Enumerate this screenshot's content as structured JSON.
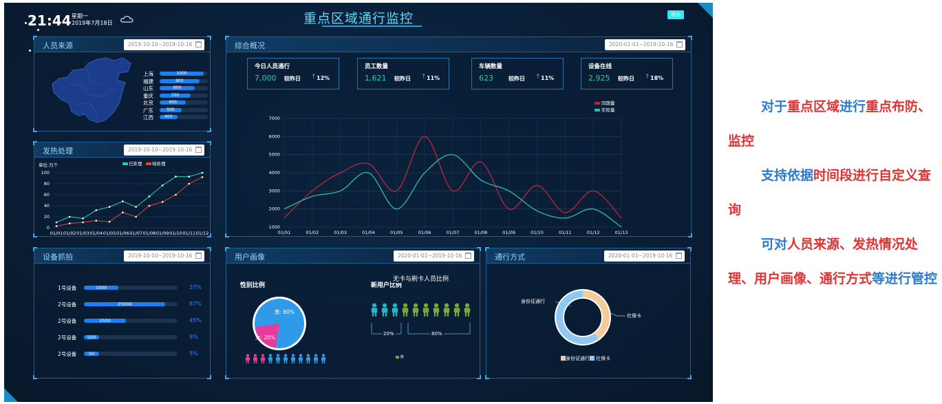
{
  "header": {
    "time": "21:44",
    "weekday": "星期一",
    "date": "2019年7月18日",
    "title": "重点区域通行监控",
    "exit_label": "退出"
  },
  "panels": {
    "personnel_source": {
      "title": "人员来源",
      "date_range": "2019-10-10~2019-10-16",
      "provinces": [
        {
          "name": "上海",
          "value": 1000
        },
        {
          "name": "福建",
          "value": 900
        },
        {
          "name": "山东",
          "value": 800
        },
        {
          "name": "重庆",
          "value": 700
        },
        {
          "name": "北京",
          "value": 600
        },
        {
          "name": "广东",
          "value": 500
        },
        {
          "name": "江西",
          "value": 400
        }
      ],
      "max": 1000
    },
    "fever_handling": {
      "title": "发热处理",
      "date_range": "2019-10-10~2019-10-16",
      "unit": "单位:万个",
      "legend": [
        "已处理",
        "待处理"
      ],
      "colors": [
        "#1fd3a7",
        "#e8472c"
      ]
    },
    "device_capture": {
      "title": "设备抓拍",
      "date_range": "2019-10-10~2019-10-16",
      "devices": [
        {
          "name": "1号设备",
          "value": "1000",
          "percent": "37%",
          "fill": 0.37
        },
        {
          "name": "2号设备",
          "value": "25000",
          "percent": "87%",
          "fill": 0.87
        },
        {
          "name": "2号设备",
          "value": "2500",
          "percent": "45%",
          "fill": 0.45
        },
        {
          "name": "2号设备",
          "value": "500",
          "percent": "9%",
          "fill": 0.09
        },
        {
          "name": "2号设备",
          "value": "50",
          "percent": "5%",
          "fill": 0.05
        }
      ]
    },
    "overview": {
      "title": "综合概况",
      "date_range": "2020-01-01~2019-10-16",
      "stats": [
        {
          "label": "今日人员通行",
          "value": "7,000",
          "compare": "较昨日",
          "percent": "12%"
        },
        {
          "label": "员工数量",
          "value": "1,621",
          "compare": "较昨日",
          "percent": "11%"
        },
        {
          "label": "车辆数量",
          "value": "623",
          "compare": "较昨日",
          "percent": "11%"
        },
        {
          "label": "设备在线",
          "value": "2,925",
          "compare": "较昨日",
          "percent": "18%"
        }
      ],
      "legend": [
        "同期量",
        "实际量"
      ],
      "colors": [
        "#c0263b",
        "#2bbfa8"
      ]
    },
    "user_profile": {
      "title": "用户画像",
      "date_range": "2020-01-01~2019-10-16",
      "gender_title": "性别比例",
      "male_label": "男: 80%",
      "female_label": "女: 20%",
      "male_fraction": 0.8,
      "card_title": "新用户比例",
      "overlay_text": "无卡与刷卡人员比例",
      "card_left": "20%",
      "card_right": "80%",
      "legend_item": "新"
    },
    "passage_mode": {
      "title": "通行方式",
      "date_range": "2020-01-01~2019-10-16",
      "items": [
        {
          "name": "身份证通行",
          "fraction": 0.4,
          "color": "#f6cb9a"
        },
        {
          "name": "社保卡",
          "fraction": 0.6,
          "color": "#8fc8f2"
        }
      ]
    }
  },
  "chart_data": [
    {
      "type": "line",
      "title": "",
      "ylabel": "单位:万个",
      "x": [
        "01/01",
        "01/02",
        "01/03",
        "01/04",
        "01/05",
        "01/06",
        "01/07",
        "01/08",
        "01/09",
        "01/10",
        "01/11",
        "01/12"
      ],
      "ylim": [
        0,
        100
      ],
      "yticks": [
        0,
        20,
        40,
        60,
        80,
        100
      ],
      "legend_position": "top",
      "series": [
        {
          "name": "已处理",
          "values": [
            10,
            20,
            17,
            32,
            38,
            48,
            38,
            57,
            77,
            93,
            93,
            100
          ]
        },
        {
          "name": "待处理",
          "values": [
            3,
            8,
            10,
            13,
            11,
            28,
            20,
            40,
            47,
            60,
            80,
            92
          ]
        }
      ]
    },
    {
      "type": "line",
      "title": "",
      "x": [
        "01/01",
        "01/02",
        "01/03",
        "01/04",
        "01/05",
        "01/06",
        "01/07",
        "01/08",
        "01/09",
        "01/10",
        "01/11",
        "01/12",
        "01/13"
      ],
      "ylim": [
        1000,
        7000
      ],
      "yticks": [
        1000,
        2000,
        3000,
        4000,
        5000,
        6000,
        7000
      ],
      "legend_position": "top-right",
      "series": [
        {
          "name": "同期量",
          "values": [
            1500,
            3000,
            4000,
            4500,
            3000,
            6000,
            3000,
            4600,
            2000,
            3300,
            1800,
            3000,
            1500
          ]
        },
        {
          "name": "实际量",
          "values": [
            2000,
            2700,
            3000,
            4000,
            2000,
            4000,
            5000,
            3600,
            3000,
            1900,
            1500,
            2000,
            1000
          ]
        }
      ]
    },
    {
      "type": "pie",
      "categories": [
        "男",
        "女"
      ],
      "values": [
        80,
        20
      ]
    },
    {
      "type": "pie",
      "categories": [
        "身份证通行",
        "社保卡"
      ],
      "values": [
        40,
        60
      ]
    }
  ],
  "side_text": {
    "p1": [
      "对于",
      "重点区域",
      "进行",
      "重点布防、监控"
    ],
    "p2": [
      "支持依据",
      "时间段进行自定义查询"
    ],
    "p3": [
      "可对",
      "人员来源、发热情况处理、用户画像、通行方式",
      "等进行管控"
    ]
  }
}
